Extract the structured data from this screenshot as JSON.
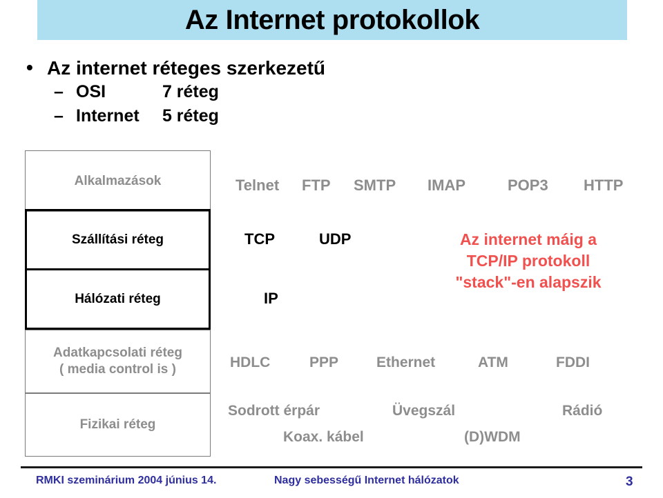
{
  "slide": {
    "title": "Az Internet protokollok",
    "title_band_color": "#addff0"
  },
  "bullets": {
    "level1": {
      "marker": "•",
      "text": "Az internet réteges szerkezetű"
    },
    "level2": [
      {
        "marker": "–",
        "name": "OSI",
        "value": "7 réteg"
      },
      {
        "marker": "–",
        "name": "Internet",
        "value": "5 réteg"
      }
    ]
  },
  "layers": [
    {
      "label": "Alkalmazások",
      "style": "thin",
      "color": "#8d8d8d"
    },
    {
      "label": "Szállítási réteg",
      "style": "thick",
      "color": "#000000"
    },
    {
      "label": "Hálózati réteg",
      "style": "thick",
      "color": "#000000"
    },
    {
      "label_line1": "Adatkapcsolati réteg",
      "label_line2": "( media control is )",
      "style": "thin",
      "color": "#8d8d8d"
    },
    {
      "label": "Fizikai réteg",
      "style": "thin",
      "color": "#8d8d8d"
    }
  ],
  "protocols": {
    "application": [
      "Telnet",
      "FTP",
      "SMTP",
      "IMAP",
      "POP3",
      "HTTP"
    ],
    "transport": [
      "TCP",
      "UDP"
    ],
    "network": [
      "IP"
    ],
    "datalink": [
      "HDLC",
      "PPP",
      "Ethernet",
      "ATM",
      "FDDI"
    ],
    "physical_line1": [
      "Sodrott érpár",
      "Üvegszál",
      "Rádió"
    ],
    "physical_line2": [
      "Koax. kábel",
      "(D)WDM"
    ]
  },
  "callout": {
    "color": "#f0514f",
    "line1": "Az internet máig a",
    "line2": "TCP/IP protokoll",
    "line3": "\"stack\"-en alapszik"
  },
  "footer": {
    "color": "#2e2e9e",
    "left": "RMKI szeminárium 2004 június 14.",
    "center": "Nagy sebességű Internet hálózatok",
    "page": "3"
  }
}
